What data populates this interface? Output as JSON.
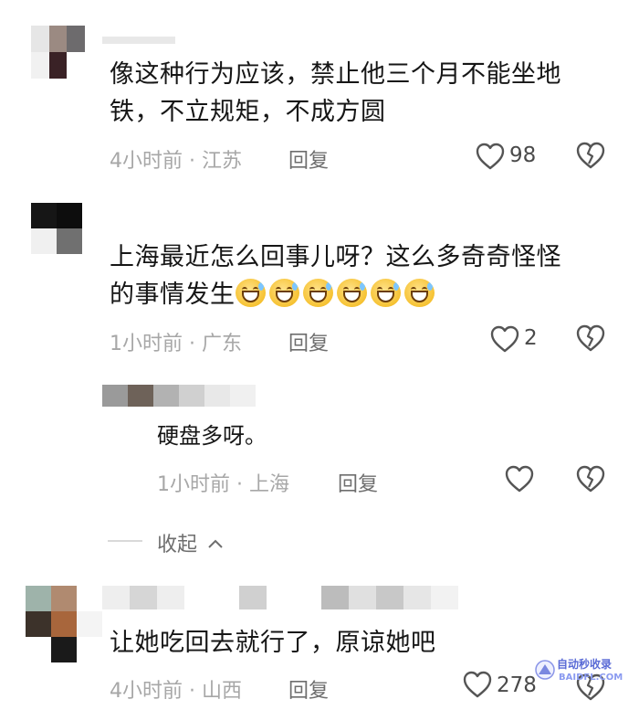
{
  "comments": [
    {
      "text": "像这种行为应该，禁止他三个月不能坐地铁，不立规矩，不成方圆",
      "text_line1": "像这种行为应该，禁止他三个月不能坐地",
      "text_line2": "铁，不立规矩，不成方圆",
      "meta": "4小时前 · 江苏",
      "reply": "回复",
      "likes": "98"
    },
    {
      "text_line1": "上海最近怎么回事儿呀？这么多奇奇怪怪",
      "text_line2": "的事情发生",
      "emoji_count": 6,
      "meta": "1小时前 · 广东",
      "reply": "回复",
      "likes": "2"
    },
    {
      "text": "让她吃回去就行了，原谅她吧",
      "meta": "4小时前 · 山西",
      "reply": "回复",
      "likes": "278"
    }
  ],
  "sub_reply": {
    "text": "硬盘多呀。",
    "meta": "1小时前 · 上海",
    "reply": "回复"
  },
  "collapse_label": "收起",
  "watermark": {
    "line1": "自动秒收录",
    "line2": "BAIDFL.COM"
  },
  "colors": {
    "text": "#161616",
    "meta": "#a7a7a7",
    "icon": "#555555"
  }
}
